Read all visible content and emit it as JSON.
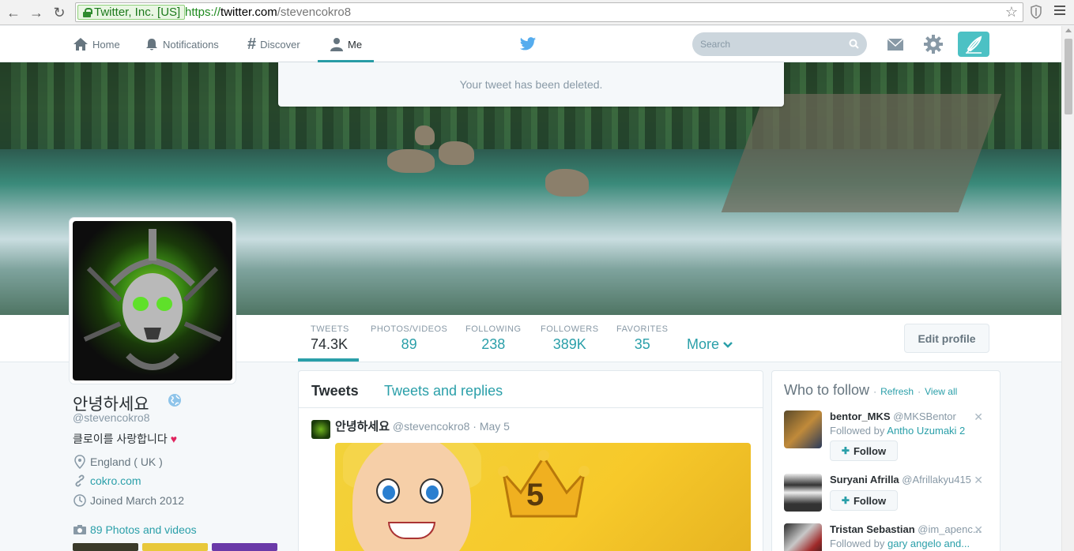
{
  "browser": {
    "ev_label": "Twitter, Inc. [US]",
    "url_scheme": "https://",
    "url_host": "twitter.com",
    "url_path": "/stevencokro8"
  },
  "topbar": {
    "nav": [
      {
        "label": "Home",
        "icon": "home-icon"
      },
      {
        "label": "Notifications",
        "icon": "bell-icon"
      },
      {
        "label": "Discover",
        "icon": "hashtag-icon"
      },
      {
        "label": "Me",
        "icon": "person-icon"
      }
    ],
    "search_placeholder": "Search"
  },
  "toast": "Your tweet has been deleted.",
  "stats": [
    {
      "label": "TWEETS",
      "value": "74.3K"
    },
    {
      "label": "PHOTOS/VIDEOS",
      "value": "89"
    },
    {
      "label": "FOLLOWING",
      "value": "238"
    },
    {
      "label": "FOLLOWERS",
      "value": "389K"
    },
    {
      "label": "FAVORITES",
      "value": "35"
    }
  ],
  "more_label": "More",
  "edit_profile_label": "Edit profile",
  "profile": {
    "name": "안녕하세요",
    "handle": "@stevencokro8",
    "bio": "클로이를 사랑합니다",
    "bio_heart": "♥",
    "location": "England ( UK )",
    "website": "cokro.com",
    "joined": "Joined March 2012",
    "photos_link": "89 Photos and videos"
  },
  "timeline": {
    "tab_tweets": "Tweets",
    "tab_replies": "Tweets and replies",
    "tweet": {
      "name": "안녕하세요",
      "handle": "@stevencokro8",
      "sep": "·",
      "date": "May 5",
      "media_number": "5"
    }
  },
  "who_to_follow": {
    "title": "Who to follow",
    "dot": "·",
    "refresh": "Refresh",
    "view_all": "View all",
    "follow_label": "Follow",
    "items": [
      {
        "name": "bentor_MKS",
        "screen_name": "@MKSBentor",
        "followed_by_prefix": "Followed by",
        "followed_by": "Antho Uzumaki 2"
      },
      {
        "name": "Suryani Afrilla",
        "screen_name": "@Afrillakyu415",
        "followed_by_prefix": "",
        "followed_by": ""
      },
      {
        "name": "Tristan Sebastian",
        "screen_name": "@im_apenc...",
        "followed_by_prefix": "Followed by",
        "followed_by": "gary angelo and..."
      }
    ]
  },
  "colors": {
    "accent": "#2a9fa9",
    "compose": "#4cc1c4"
  }
}
